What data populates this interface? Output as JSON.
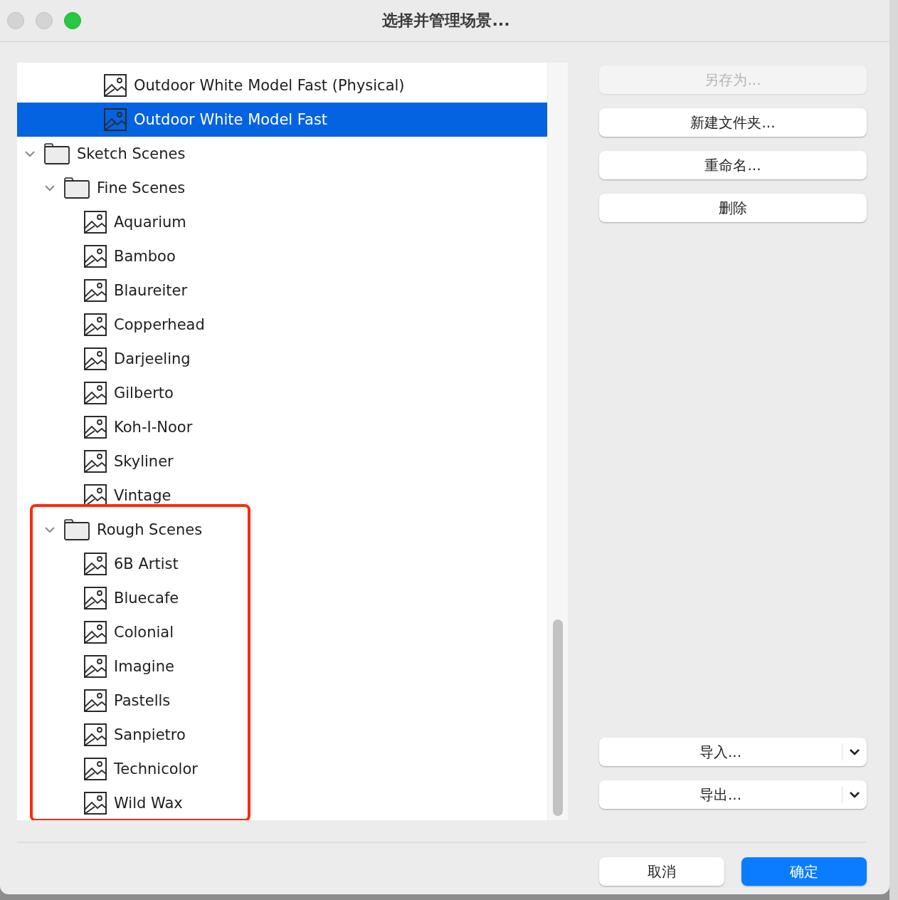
{
  "window": {
    "title": "选择并管理场景..."
  },
  "tree": {
    "scrolled_rows": [
      {
        "label": "Outdoor White Model Fast (Physical)",
        "kind": "scene",
        "selected": false
      },
      {
        "label": "Outdoor White Model Fast",
        "kind": "scene",
        "selected": true
      }
    ],
    "items": [
      {
        "label": "Sketch Scenes",
        "kind": "folder",
        "expanded": true,
        "selected": false,
        "children": [
          {
            "label": "Fine Scenes",
            "kind": "folder",
            "expanded": true,
            "selected": false,
            "children": [
              {
                "label": "Aquarium",
                "kind": "scene",
                "selected": false
              },
              {
                "label": "Bamboo",
                "kind": "scene",
                "selected": false
              },
              {
                "label": "Blaureiter",
                "kind": "scene",
                "selected": false
              },
              {
                "label": "Copperhead",
                "kind": "scene",
                "selected": false
              },
              {
                "label": "Darjeeling",
                "kind": "scene",
                "selected": false
              },
              {
                "label": "Gilberto",
                "kind": "scene",
                "selected": false
              },
              {
                "label": "Koh-I-Noor",
                "kind": "scene",
                "selected": false
              },
              {
                "label": "Skyliner",
                "kind": "scene",
                "selected": false
              },
              {
                "label": "Vintage",
                "kind": "scene",
                "selected": false
              }
            ]
          },
          {
            "label": "Rough Scenes",
            "kind": "folder",
            "expanded": true,
            "selected": false,
            "highlighted": true,
            "children": [
              {
                "label": "6B Artist",
                "kind": "scene",
                "selected": false
              },
              {
                "label": "Bluecafe",
                "kind": "scene",
                "selected": false
              },
              {
                "label": "Colonial",
                "kind": "scene",
                "selected": false
              },
              {
                "label": "Imagine",
                "kind": "scene",
                "selected": false
              },
              {
                "label": "Pastells",
                "kind": "scene",
                "selected": false
              },
              {
                "label": "Sanpietro",
                "kind": "scene",
                "selected": false
              },
              {
                "label": "Technicolor",
                "kind": "scene",
                "selected": false
              },
              {
                "label": "Wild Wax",
                "kind": "scene",
                "selected": false
              }
            ]
          }
        ]
      }
    ]
  },
  "side_buttons": [
    {
      "label": "另存为...",
      "disabled": true
    },
    {
      "label": "新建文件夹...",
      "disabled": false
    },
    {
      "label": "重命名...",
      "disabled": false
    },
    {
      "label": "删除",
      "disabled": false
    }
  ],
  "menu_buttons": [
    {
      "label": "导入..."
    },
    {
      "label": "导出..."
    }
  ],
  "footer_buttons": [
    {
      "label": "取消",
      "kind": "cancel"
    },
    {
      "label": "确定",
      "kind": "default"
    }
  ]
}
